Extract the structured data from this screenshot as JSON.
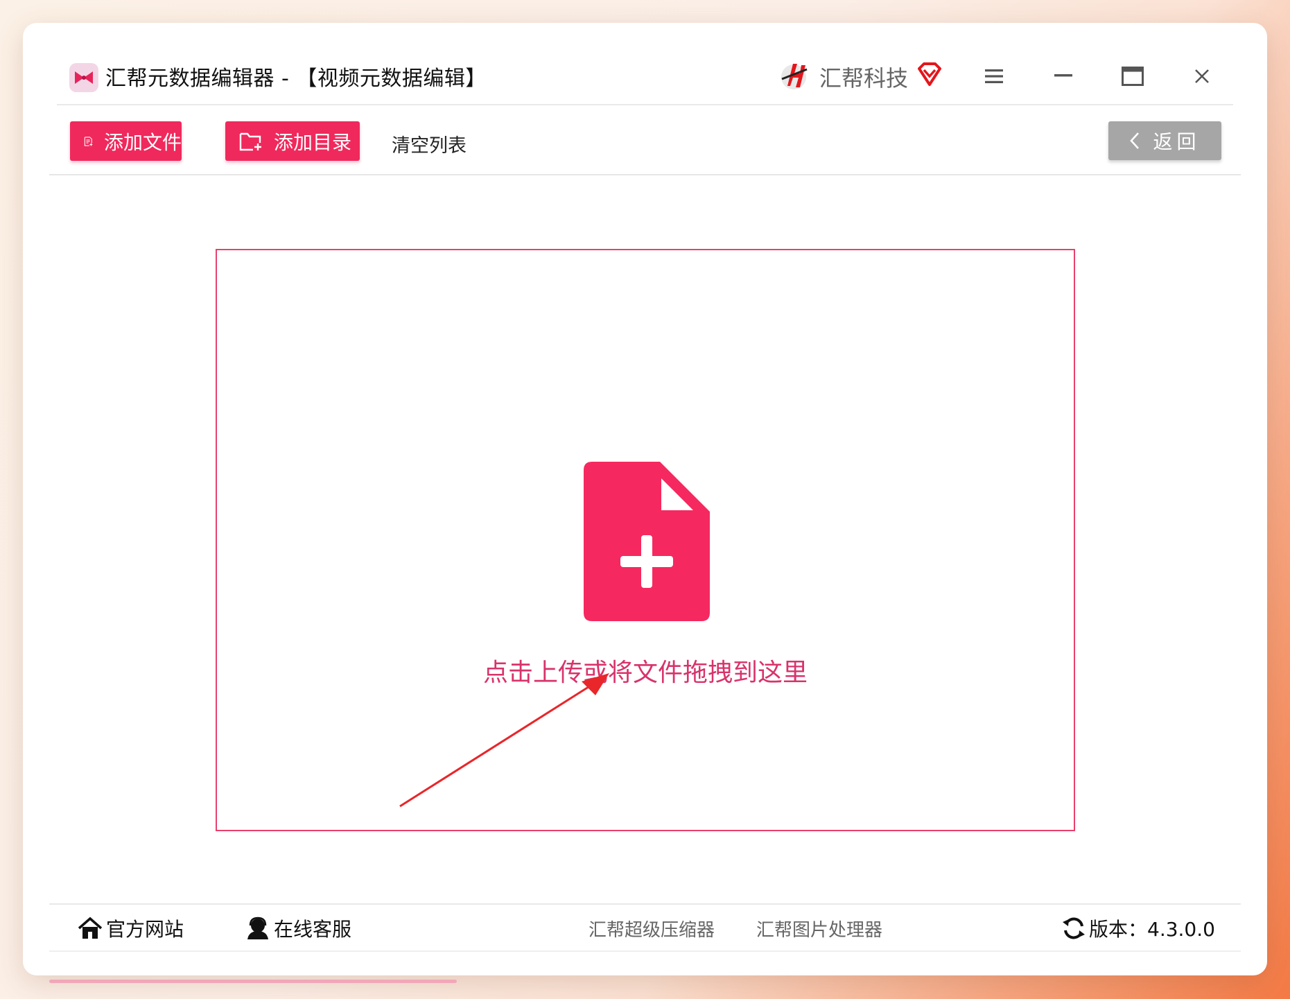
{
  "app": {
    "title": "汇帮元数据编辑器 - 【视频元数据编辑】",
    "brand_name": "汇帮科技",
    "icons": {
      "app_logo": "bowtie-logo-icon",
      "brand": "huibang-logo-icon",
      "vip": "vip-diamond-icon",
      "menu": "hamburger-icon",
      "minimize": "minimize-icon",
      "maximize": "maximize-icon",
      "close": "close-icon"
    }
  },
  "toolbar": {
    "add_file_label": "添加文件",
    "add_dir_label": "添加目录",
    "clear_label": "清空列表",
    "back_label": "返回"
  },
  "dropzone": {
    "hint": "点击上传或将文件拖拽到这里",
    "icon": "file-add-icon"
  },
  "footer": {
    "official_site": "官方网站",
    "online_service": "在线客服",
    "compressor": "汇帮超级压缩器",
    "image_processor": "汇帮图片处理器",
    "version_label": "版本：4.3.0.0"
  },
  "colors": {
    "accent": "#f0295c",
    "accent_text": "#d8336b",
    "back_button": "#a6a6a6"
  }
}
